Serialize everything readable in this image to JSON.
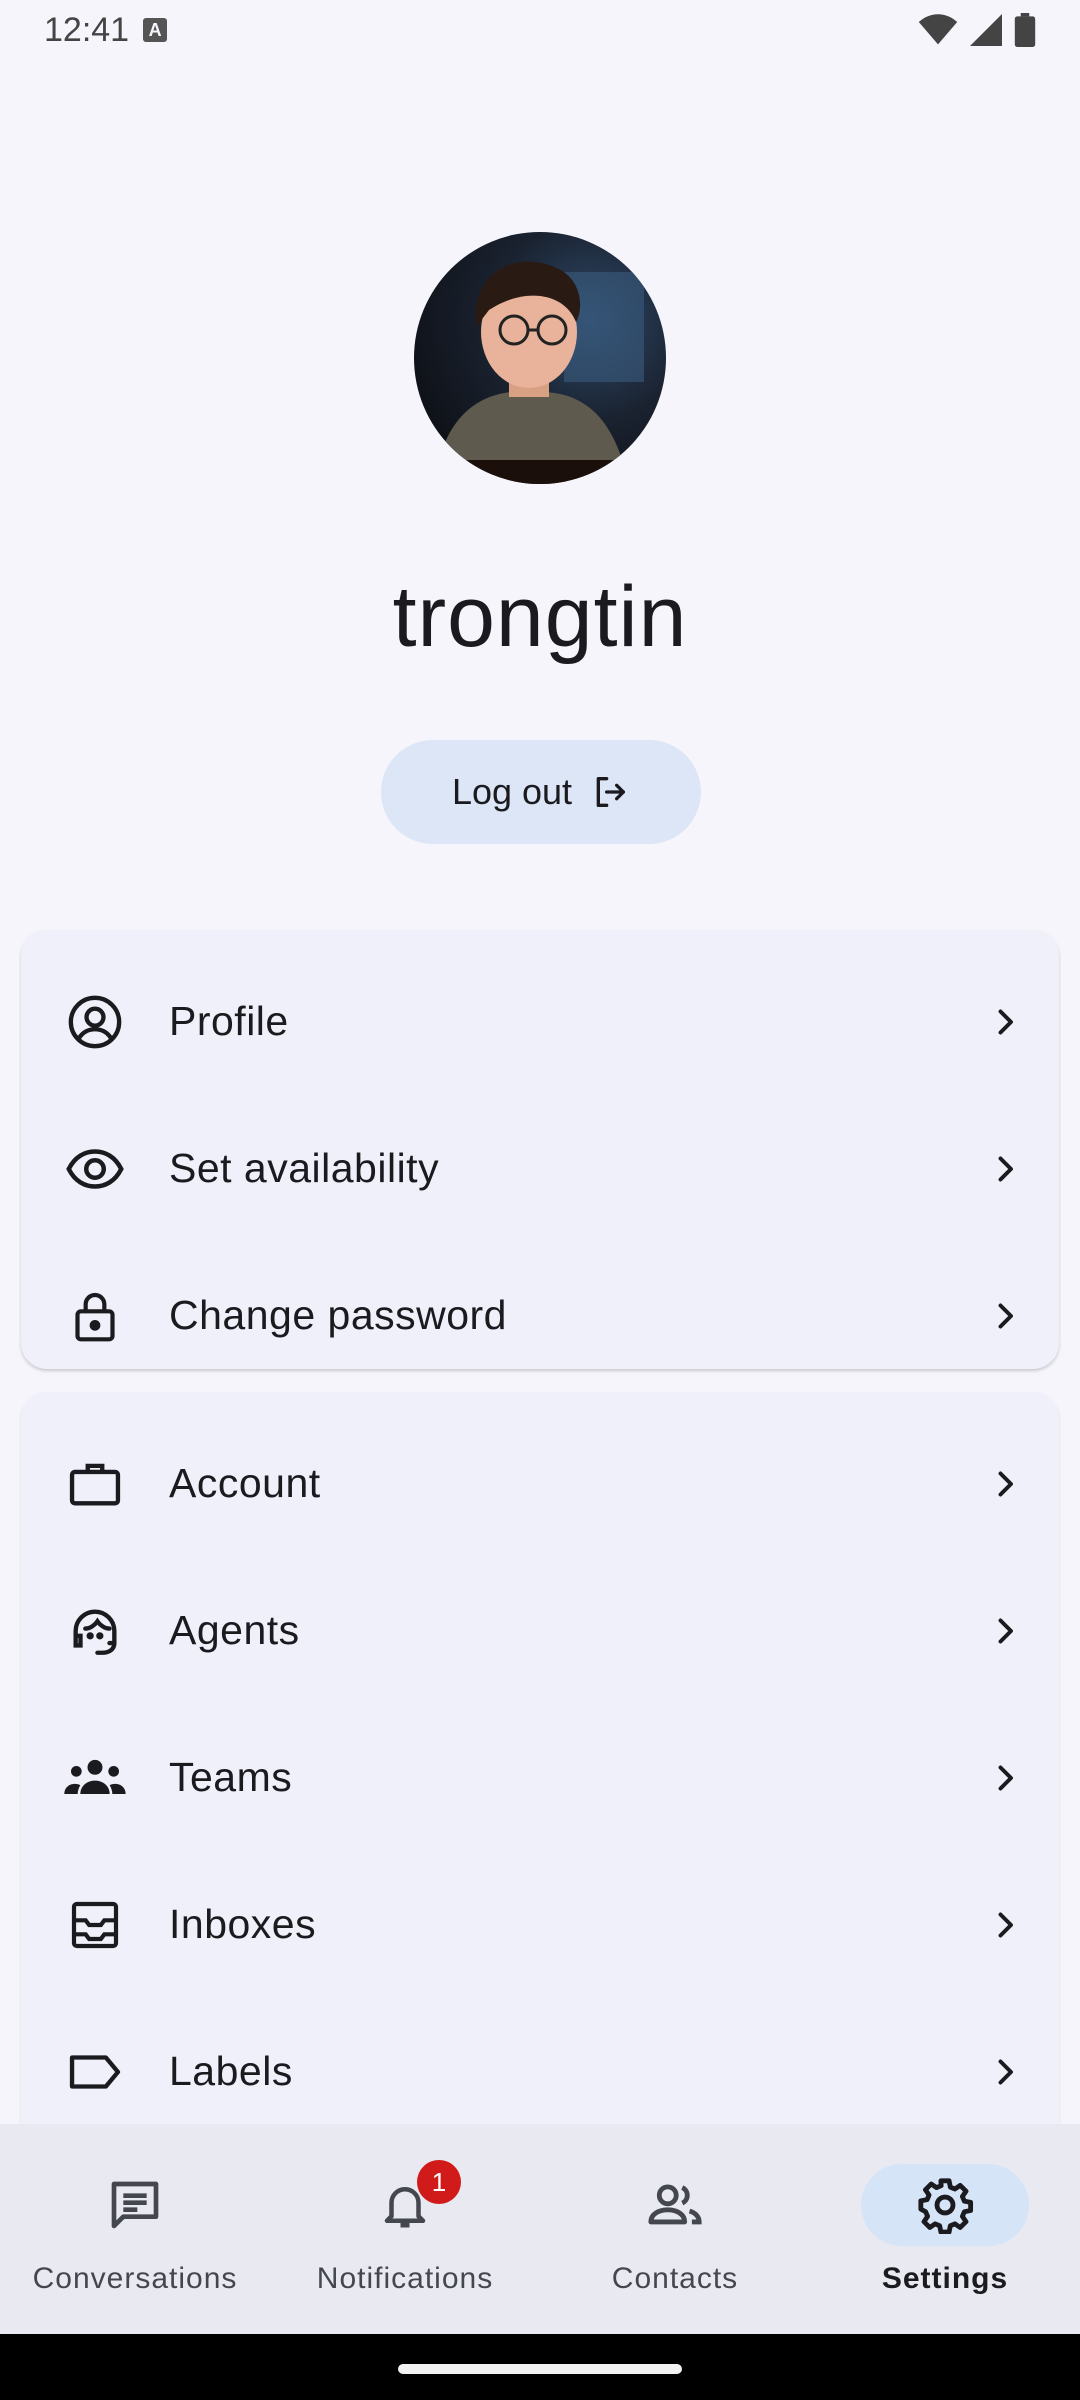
{
  "status_bar": {
    "time": "12:41"
  },
  "profile": {
    "username": "trongtin",
    "logout_label": "Log out"
  },
  "menu_group_1": [
    {
      "label": "Profile",
      "icon": "account-circle-icon"
    },
    {
      "label": "Set availability",
      "icon": "eye-icon"
    },
    {
      "label": "Change password",
      "icon": "lock-icon"
    }
  ],
  "menu_group_2": [
    {
      "label": "Account",
      "icon": "briefcase-icon"
    },
    {
      "label": "Agents",
      "icon": "support-agent-icon"
    },
    {
      "label": "Teams",
      "icon": "groups-icon"
    },
    {
      "label": "Inboxes",
      "icon": "inbox-icon"
    },
    {
      "label": "Labels",
      "icon": "label-icon"
    }
  ],
  "bottom_nav": {
    "items": [
      {
        "label": "Conversations",
        "icon": "chat-icon"
      },
      {
        "label": "Notifications",
        "icon": "bell-icon",
        "badge": "1"
      },
      {
        "label": "Contacts",
        "icon": "people-icon"
      },
      {
        "label": "Settings",
        "icon": "gear-icon",
        "active": true
      }
    ]
  },
  "colors": {
    "background": "#f5f5fb",
    "card": "#eff0f9",
    "logout_button": "#dce6f6",
    "active_nav_pill": "#d6e4f7",
    "badge": "#d11a1a"
  }
}
